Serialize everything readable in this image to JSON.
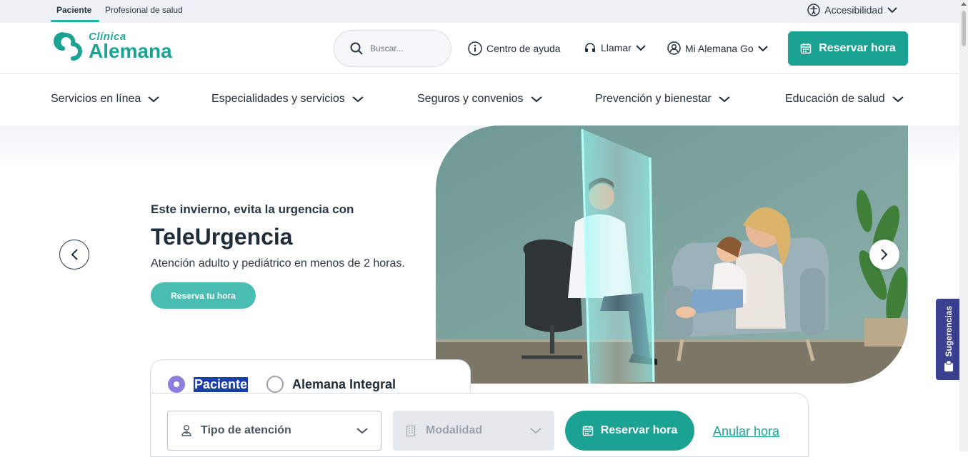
{
  "audience_tabs": [
    {
      "label": "Paciente",
      "active": true
    },
    {
      "label": "Profesional de salud",
      "active": false
    }
  ],
  "accessibility": {
    "label": "Accesibilidad"
  },
  "logo": {
    "sub": "Clínica",
    "main": "Alemana"
  },
  "search": {
    "placeholder": "Buscar..."
  },
  "header_links": {
    "help": "Centro de ayuda",
    "call": "Llamar",
    "app": "Mi Alemana Go"
  },
  "header_cta": "Reservar hora",
  "nav": [
    "Servicios en línea",
    "Especialidades y servicios",
    "Seguros y convenios",
    "Prevención y bienestar",
    "Educación de salud"
  ],
  "hero": {
    "eyebrow": "Este invierno, evita la urgencia con",
    "title": "TeleUrgencia",
    "subtitle": "Atención adulto y pediátrico en menos de 2 horas.",
    "cta": "Reserva tu hora"
  },
  "booking": {
    "radios": [
      {
        "label": "Paciente",
        "selected": true
      },
      {
        "label": "Alemana Integral",
        "selected": false
      }
    ],
    "tipo": "Tipo de atención",
    "modalidad": "Modalidad",
    "reserve": "Reservar hora",
    "cancel": "Anular hora"
  },
  "feedback": "Sugerencias",
  "colors": {
    "brand": "#1aa393",
    "radio_accent": "#8d7fe0",
    "feedback_bg": "#3b3f8f"
  }
}
